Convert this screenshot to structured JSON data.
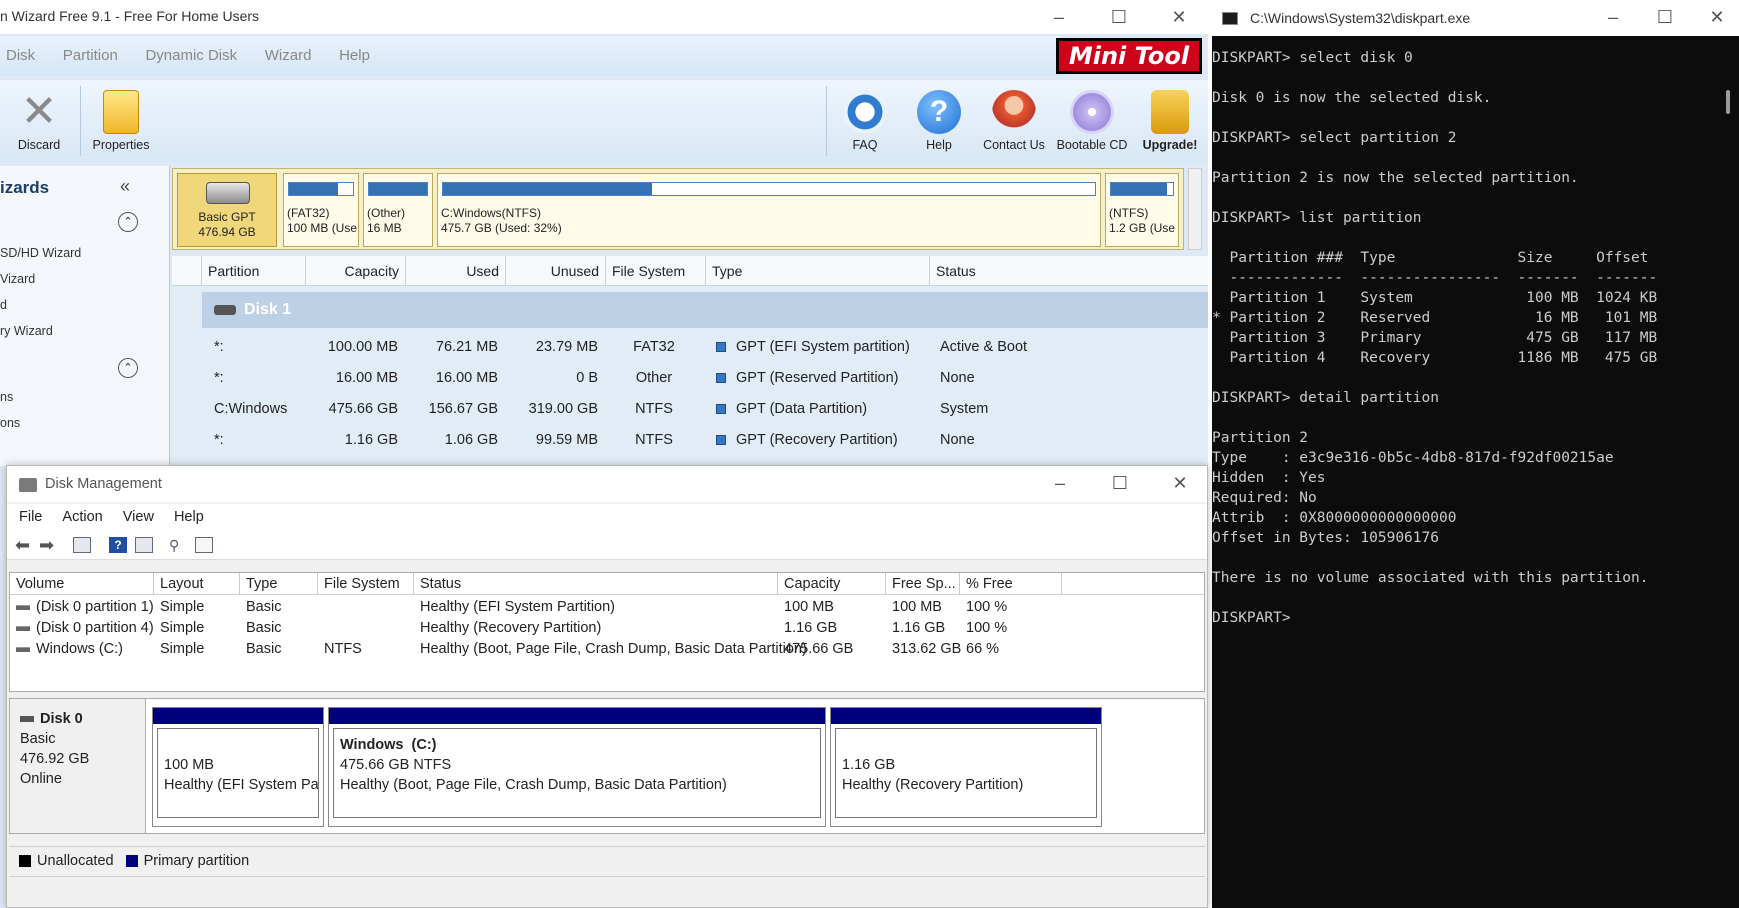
{
  "minitool": {
    "title": "n Wizard Free 9.1 - Free For Home Users",
    "menu": [
      "Disk",
      "Partition",
      "Dynamic Disk",
      "Wizard",
      "Help"
    ],
    "logo": "Mini Tool",
    "toolbar_left": [
      {
        "label": "Discard",
        "icon": "discard-x-icon"
      },
      {
        "label": "Properties",
        "icon": "properties-icon"
      }
    ],
    "toolbar_right": [
      {
        "label": "FAQ",
        "icon": "lifebuoy-icon"
      },
      {
        "label": "Help",
        "icon": "question-icon"
      },
      {
        "label": "Contact Us",
        "icon": "contact-icon"
      },
      {
        "label": "Bootable CD",
        "icon": "cd-icon"
      },
      {
        "label": "Upgrade!",
        "icon": "cart-icon"
      }
    ],
    "sidebar": {
      "heading": "izards",
      "items": [
        "SD/HD Wizard",
        "Vizard",
        "d",
        "ry Wizard",
        "ns",
        "ons"
      ]
    },
    "disk_map": {
      "disk_label": "Basic GPT",
      "disk_size": "476.94 GB",
      "partitions": [
        {
          "fs": "(FAT32)",
          "info": "100 MB (Use",
          "used_fraction": 0.76
        },
        {
          "fs": "(Other)",
          "info": "16 MB",
          "used_fraction": 1.0
        },
        {
          "fs": "C:Windows(NTFS)",
          "info": "475.7 GB (Used: 32%)",
          "used_fraction": 0.32
        },
        {
          "fs": "(NTFS)",
          "info": "1.2 GB (Use",
          "used_fraction": 0.91
        }
      ]
    },
    "table": {
      "headers": [
        "Partition",
        "Capacity",
        "Used",
        "Unused",
        "File System",
        "Type",
        "Status"
      ],
      "disk_group": "Disk 1",
      "rows": [
        {
          "partition": "*:",
          "capacity": "100.00 MB",
          "used": "76.21 MB",
          "unused": "23.79 MB",
          "fs": "FAT32",
          "type": "GPT (EFI System partition)",
          "status": "Active & Boot"
        },
        {
          "partition": "*:",
          "capacity": "16.00 MB",
          "used": "16.00 MB",
          "unused": "0 B",
          "fs": "Other",
          "type": "GPT (Reserved Partition)",
          "status": "None"
        },
        {
          "partition": "C:Windows",
          "capacity": "475.66 GB",
          "used": "156.67 GB",
          "unused": "319.00 GB",
          "fs": "NTFS",
          "type": "GPT (Data Partition)",
          "status": "System"
        },
        {
          "partition": "*:",
          "capacity": "1.16 GB",
          "used": "1.06 GB",
          "unused": "99.59 MB",
          "fs": "NTFS",
          "type": "GPT (Recovery Partition)",
          "status": "None"
        }
      ]
    }
  },
  "disk_management": {
    "title": "Disk Management",
    "menu": [
      "File",
      "Action",
      "View",
      "Help"
    ],
    "list_headers": [
      "Volume",
      "Layout",
      "Type",
      "File System",
      "Status",
      "Capacity",
      "Free Sp...",
      "% Free"
    ],
    "volumes": [
      {
        "volume": "(Disk 0 partition 1)",
        "layout": "Simple",
        "type": "Basic",
        "fs": "",
        "status": "Healthy (EFI System Partition)",
        "capacity": "100 MB",
        "free": "100 MB",
        "pct": "100 %"
      },
      {
        "volume": "(Disk 0 partition 4)",
        "layout": "Simple",
        "type": "Basic",
        "fs": "",
        "status": "Healthy (Recovery Partition)",
        "capacity": "1.16 GB",
        "free": "1.16 GB",
        "pct": "100 %"
      },
      {
        "volume": "Windows (C:)",
        "layout": "Simple",
        "type": "Basic",
        "fs": "NTFS",
        "status": "Healthy (Boot, Page File, Crash Dump, Basic Data Partition)",
        "capacity": "475.66 GB",
        "free": "313.62 GB",
        "pct": "66 %"
      }
    ],
    "disk": {
      "name": "Disk 0",
      "type": "Basic",
      "size": "476.92 GB",
      "state": "Online"
    },
    "graph_partitions": [
      {
        "title": "",
        "size": "100 MB",
        "status": "Healthy (EFI System Partiti"
      },
      {
        "title": "Windows  (C:)",
        "size": "475.66 GB NTFS",
        "status": "Healthy (Boot, Page File, Crash Dump, Basic Data Partition)"
      },
      {
        "title": "",
        "size": "1.16 GB",
        "status": "Healthy (Recovery Partition)"
      }
    ],
    "legend": [
      {
        "label": "Unallocated",
        "color": "#000000"
      },
      {
        "label": "Primary partition",
        "color": "#00007a"
      }
    ]
  },
  "cmd": {
    "title": "C:\\Windows\\System32\\diskpart.exe",
    "output": "DISKPART> select disk 0\n\nDisk 0 is now the selected disk.\n\nDISKPART> select partition 2\n\nPartition 2 is now the selected partition.\n\nDISKPART> list partition\n\n  Partition ###  Type              Size     Offset\n  -------------  ----------------  -------  -------\n  Partition 1    System             100 MB  1024 KB\n* Partition 2    Reserved            16 MB   101 MB\n  Partition 3    Primary            475 GB   117 MB\n  Partition 4    Recovery          1186 MB   475 GB\n\nDISKPART> detail partition\n\nPartition 2\nType    : e3c9e316-0b5c-4db8-817d-f92df00215ae\nHidden  : Yes\nRequired: No\nAttrib  : 0X8000000000000000\nOffset in Bytes: 105906176\n\nThere is no volume associated with this partition.\n\nDISKPART>"
  },
  "colors": {
    "accent": "#3572b5",
    "disk_bar": "#00007a",
    "terminal_bg": "#0c0c0c"
  }
}
